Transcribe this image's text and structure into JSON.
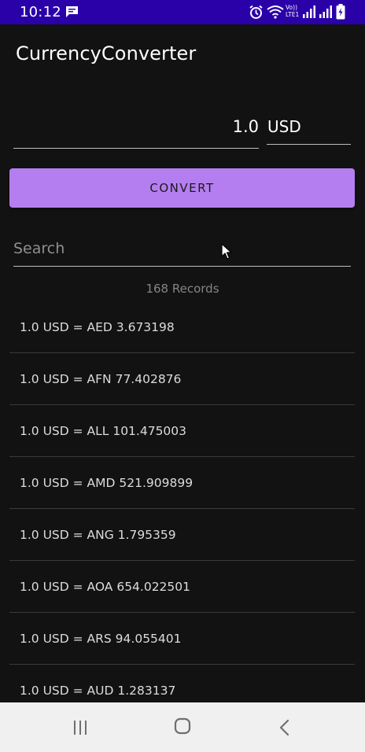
{
  "status_bar": {
    "time": "10:12",
    "icons": [
      "message-icon",
      "alarm-icon",
      "wifi-icon",
      "volte-icon",
      "signal-icon",
      "signal-icon",
      "battery-icon"
    ],
    "volte_label_top": "Vo))",
    "volte_label_bottom": "LTE1"
  },
  "app": {
    "title": "CurrencyConverter"
  },
  "converter": {
    "amount_value": "1.0",
    "currency_value": "USD",
    "convert_label": "CONVERT"
  },
  "search": {
    "placeholder": "Search"
  },
  "records": {
    "count_label": "168 Records"
  },
  "rates": [
    {
      "text": "1.0 USD = AED 3.673198"
    },
    {
      "text": "1.0 USD = AFN 77.402876"
    },
    {
      "text": "1.0 USD = ALL 101.475003"
    },
    {
      "text": "1.0 USD = AMD 521.909899"
    },
    {
      "text": "1.0 USD = ANG 1.795359"
    },
    {
      "text": "1.0 USD = AOA 654.022501"
    },
    {
      "text": "1.0 USD = ARS 94.055401"
    },
    {
      "text": "1.0 USD = AUD 1.283137"
    }
  ],
  "colors": {
    "status_bar": "#2a00a8",
    "background": "#121212",
    "accent": "#b57ef0",
    "nav_bar": "#f0f0f0"
  },
  "nav_bar": {
    "icons": [
      "recents-icon",
      "home-icon",
      "back-icon"
    ]
  }
}
